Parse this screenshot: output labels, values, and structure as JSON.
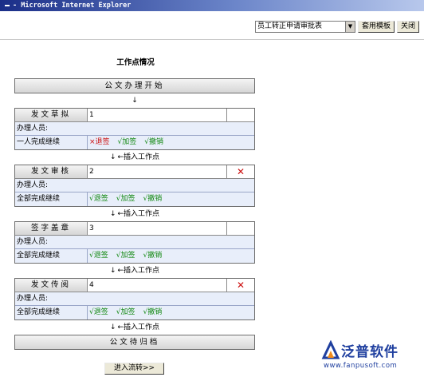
{
  "window": {
    "title": "- Microsoft Internet Explorer"
  },
  "toolbar": {
    "template_select_value": "员工转正申请审批表",
    "apply_template_label": "套用模板",
    "close_label": "关闭"
  },
  "page": {
    "title": "工作点情况"
  },
  "flow": {
    "start_label": "公文办理开始",
    "end_label": "公文待归档",
    "arrow_glyph": "↓",
    "insert_label": "←插入工作点",
    "handler_label": "办理人员:",
    "nodes": [
      {
        "name": "发文草拟",
        "number": "1",
        "deletable": false,
        "mode": "一人完成继续",
        "actions": [
          {
            "label": "×退签",
            "enabled": false
          },
          {
            "label": "√加签",
            "enabled": true
          },
          {
            "label": "√撤销",
            "enabled": true
          }
        ]
      },
      {
        "name": "发文审核",
        "number": "2",
        "deletable": true,
        "mode": "全部完成继续",
        "actions": [
          {
            "label": "√退签",
            "enabled": true
          },
          {
            "label": "√加签",
            "enabled": true
          },
          {
            "label": "√撤销",
            "enabled": true
          }
        ]
      },
      {
        "name": "签字盖章",
        "number": "3",
        "deletable": false,
        "mode": "全部完成继续",
        "actions": [
          {
            "label": "√退签",
            "enabled": true
          },
          {
            "label": "√加签",
            "enabled": true
          },
          {
            "label": "√撤销",
            "enabled": true
          }
        ]
      },
      {
        "name": "发文传阅",
        "number": "4",
        "deletable": true,
        "mode": "全部完成继续",
        "actions": [
          {
            "label": "√退签",
            "enabled": true
          },
          {
            "label": "√加签",
            "enabled": true
          },
          {
            "label": "√撤销",
            "enabled": true
          }
        ]
      }
    ],
    "delete_glyph": "✕",
    "enter_label": "进入流转>>"
  },
  "logo": {
    "name": "泛普软件",
    "url": "www.fanpusoft.com"
  },
  "colors": {
    "enabled_action": "#118811",
    "disabled_action": "#cc1111",
    "delete_icon": "#cc1111",
    "logo_blue": "#1f3f9f",
    "logo_orange": "#f08a1c"
  }
}
